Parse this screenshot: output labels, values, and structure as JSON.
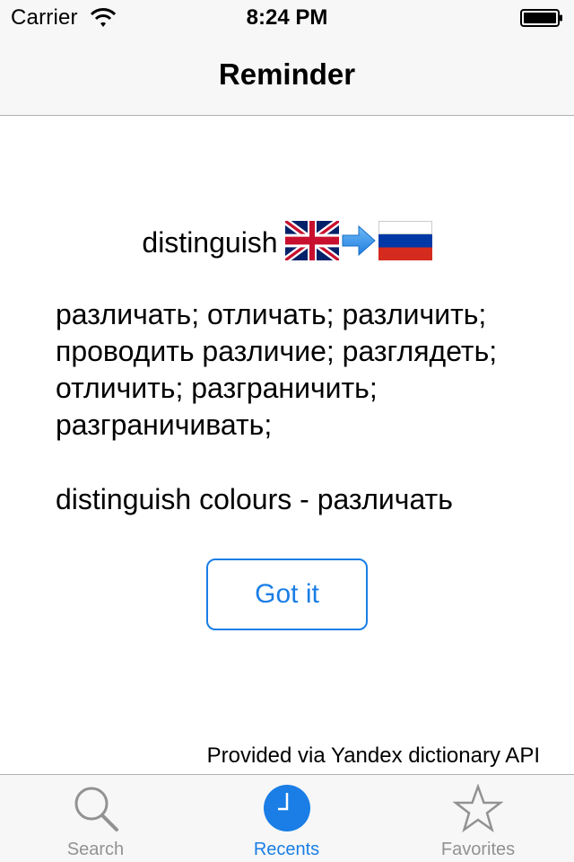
{
  "status_bar": {
    "carrier": "Carrier",
    "time": "8:24 PM"
  },
  "nav": {
    "title": "Reminder"
  },
  "card": {
    "word": "distinguish",
    "source_flag": "uk-flag-icon",
    "direction_icon": "arrow-right-icon",
    "target_flag": "russia-flag-icon",
    "translations": "различать; отличать; различить; проводить различие; разглядеть; отличить; разграничить; разграничивать;",
    "example": "distinguish colours - различать",
    "confirm_label": "Got it"
  },
  "footer": {
    "provider": "Provided via Yandex dictionary API"
  },
  "tabs": [
    {
      "label": "Search",
      "icon": "search-icon",
      "active": false
    },
    {
      "label": "Recents",
      "icon": "clock-icon",
      "active": true
    },
    {
      "label": "Favorites",
      "icon": "star-icon",
      "active": false
    }
  ],
  "colors": {
    "accent": "#1a7ee6",
    "inactive": "#929292",
    "bar_background": "#f7f7f7"
  }
}
